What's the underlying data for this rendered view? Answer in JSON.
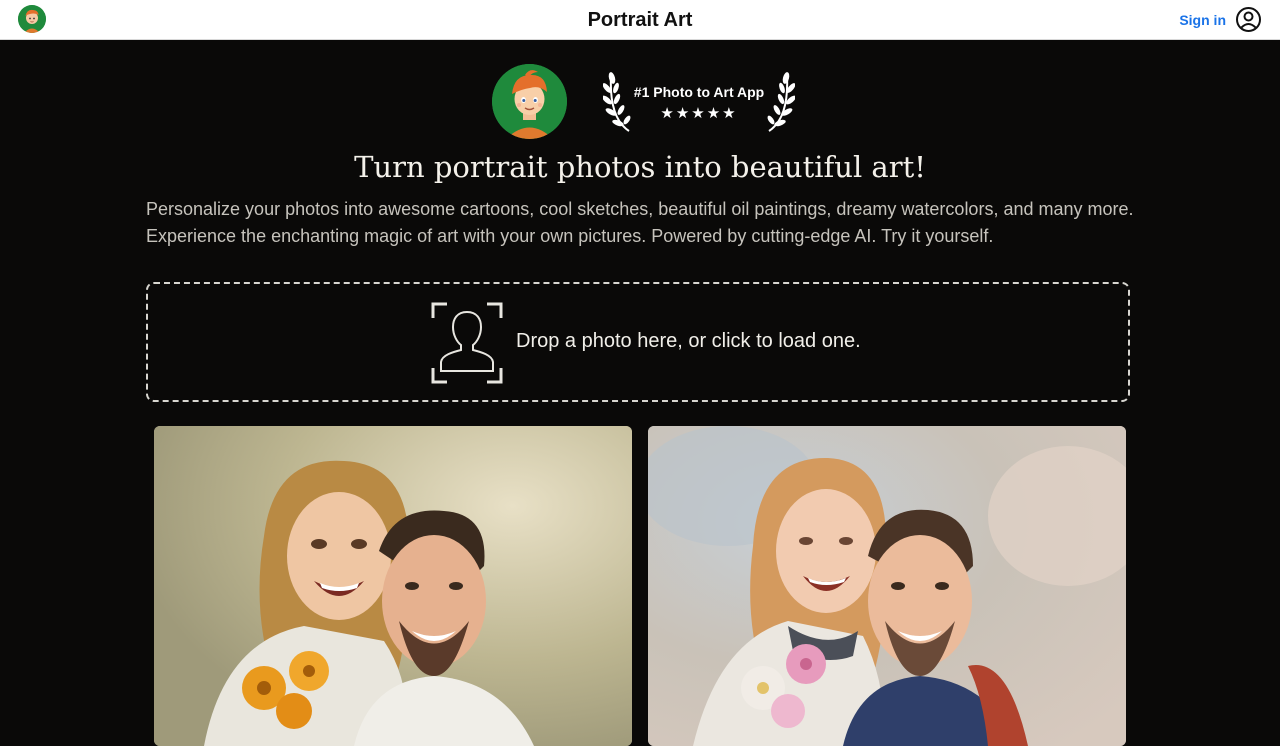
{
  "header": {
    "title": "Portrait Art",
    "sign_in_label": "Sign in",
    "logo_icon": "cartoon-avatar-icon",
    "account_icon": "account-circle-icon"
  },
  "hero": {
    "award_title": "#1 Photo to Art App",
    "award_stars": "★★★★★",
    "rating": 5,
    "headline": "Turn portrait photos into beautiful art!",
    "intro": "Personalize your photos into awesome cartoons, cool sketches, beautiful oil paintings, dreamy watercolors, and many more. Experience the enchanting magic of art with your own pictures. Powered by cutting-edge AI. Try it yourself."
  },
  "dropzone": {
    "text": "Drop a photo here, or click to load one.",
    "icon": "portrait-frame-icon"
  },
  "colors": {
    "background": "#0a0908",
    "link": "#1a73e8",
    "avatar_bg": "#1f8a3c"
  }
}
